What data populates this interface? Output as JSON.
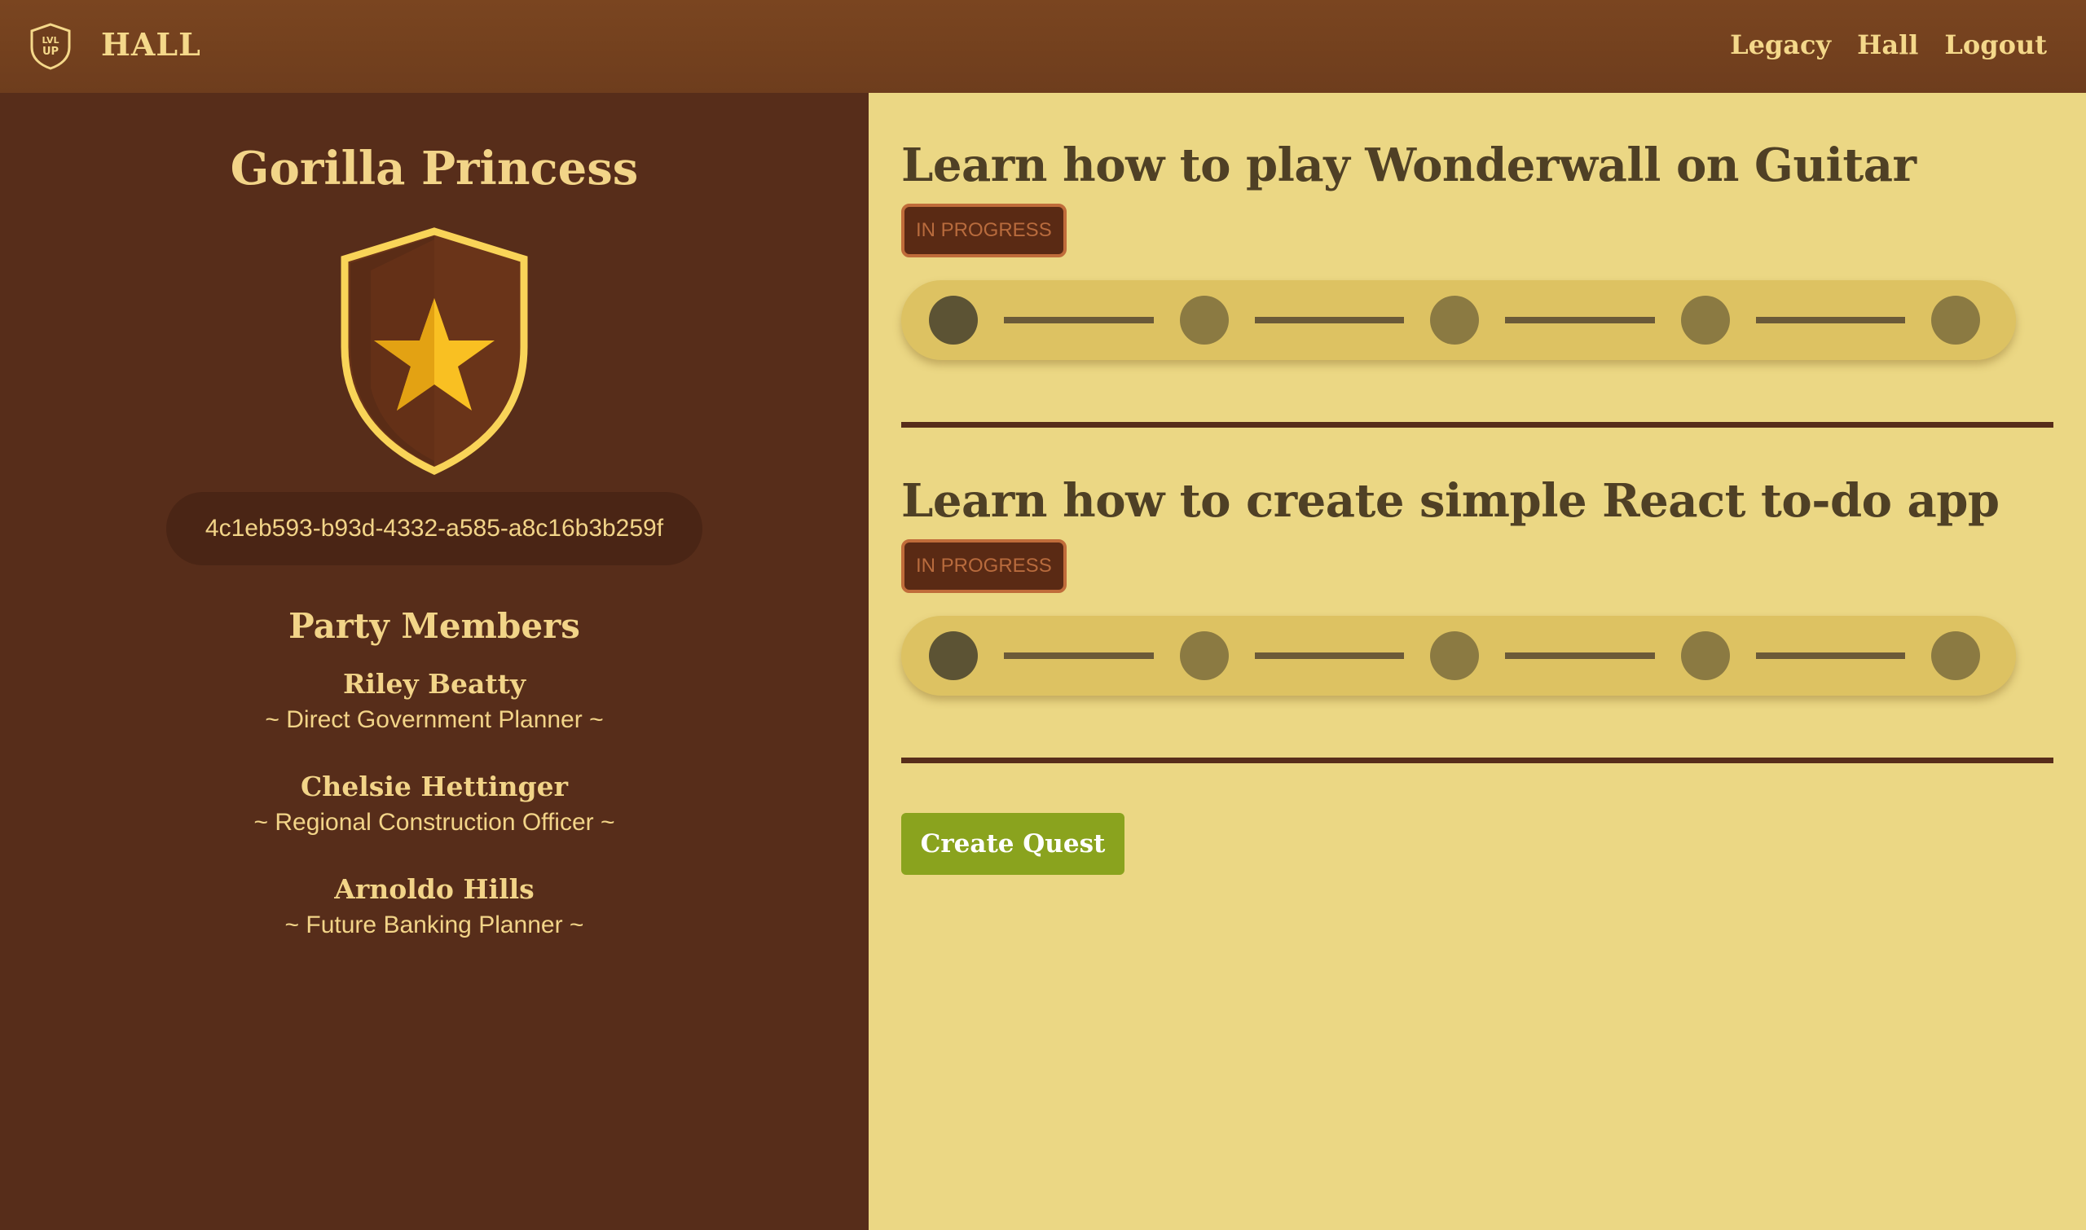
{
  "app": {
    "title": "HALL",
    "logo_text_top": "LVL",
    "logo_text_bottom": "UP"
  },
  "nav": {
    "links": [
      "Legacy",
      "Hall",
      "Logout"
    ]
  },
  "sidebar": {
    "guild_name": "Gorilla Princess",
    "crest_icon": "shield-star-icon",
    "guild_id": "4c1eb593-b93d-4332-a585-a8c16b3b259f",
    "party_heading": "Party Members",
    "members": [
      {
        "name": "Riley Beatty",
        "title": "~ Direct Government Planner ~"
      },
      {
        "name": "Chelsie Hettinger",
        "title": "~ Regional Construction Officer ~"
      },
      {
        "name": "Arnoldo Hills",
        "title": "~ Future Banking Planner ~"
      }
    ]
  },
  "quests": [
    {
      "title": "Learn how to play Wonderwall on Guitar",
      "status": "IN PROGRESS",
      "total_steps": 5,
      "completed_steps": 1
    },
    {
      "title": "Learn how to create simple React to-do app",
      "status": "IN PROGRESS",
      "total_steps": 5,
      "completed_steps": 1
    }
  ],
  "actions": {
    "create_quest_label": "Create Quest"
  },
  "colors": {
    "navbar": "#723f1e",
    "sidebar": "#572d1a",
    "main_background": "#ebd784",
    "accent_gold": "#f2d488",
    "create_button": "#8aa31e",
    "status_badge": "#5a2a14"
  }
}
